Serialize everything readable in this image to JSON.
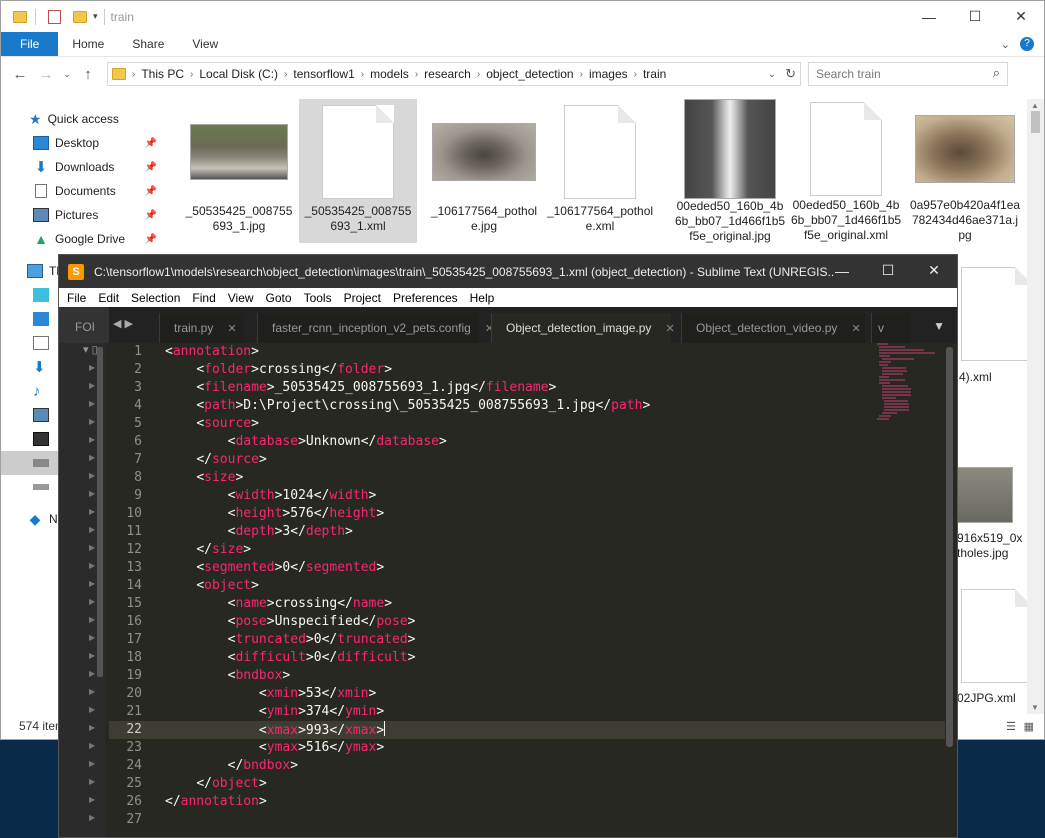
{
  "explorer": {
    "title": "train",
    "ribbon_tabs": [
      "File",
      "Home",
      "Share",
      "View"
    ],
    "breadcrumb": [
      "This PC",
      "Local Disk (C:)",
      "tensorflow1",
      "models",
      "research",
      "object_detection",
      "images",
      "train"
    ],
    "search_placeholder": "Search train",
    "nav": {
      "quick_access": "Quick access",
      "pinned": [
        "Desktop",
        "Downloads",
        "Documents",
        "Pictures",
        "Google Drive"
      ],
      "this_pc_partial": "Th",
      "network_partial": "N"
    },
    "files": [
      {
        "name": "_50535425_008755693_1.jpg",
        "type": "photo",
        "selected": false
      },
      {
        "name": "_50535425_008755693_1.xml",
        "type": "doc",
        "selected": true
      },
      {
        "name": "_106177564_pothole.jpg",
        "type": "photo",
        "selected": false
      },
      {
        "name": "_106177564_pothole.xml",
        "type": "doc",
        "selected": false
      },
      {
        "name": "00eded50_160b_4b6b_bb07_1d466f1b5f5e_original.jpg",
        "type": "photo",
        "selected": false
      },
      {
        "name": "00eded50_160b_4b6b_bb07_1d466f1b5f5e_original.xml",
        "type": "doc",
        "selected": false
      },
      {
        "name": "0a957e0b420a4f1ea782434d46ae371a.jpg",
        "type": "photo",
        "selected": false
      }
    ],
    "partial_labels": [
      "4).xml",
      "916x519_0x",
      "tholes.jpg",
      "02JPG.xml"
    ],
    "status": "574 item"
  },
  "sublime": {
    "title": "C:\\tensorflow1\\models\\research\\object_detection\\images\\train\\_50535425_008755693_1.xml (object_detection) - Sublime Text (UNREGIS...",
    "menu": [
      "File",
      "Edit",
      "Selection",
      "Find",
      "View",
      "Goto",
      "Tools",
      "Project",
      "Preferences",
      "Help"
    ],
    "sidebar_header": "FOI",
    "tabs": [
      "train.py",
      "faster_rcnn_inception_v2_pets.config",
      "Object_detection_image.py",
      "Object_detection_video.py",
      "v"
    ],
    "active_tab_index": 1,
    "current_line": 22,
    "lines": [
      "<annotation>",
      "    <folder>crossing</folder>",
      "    <filename>_50535425_008755693_1.jpg</filename>",
      "    <path>D:\\Project\\crossing\\_50535425_008755693_1.jpg</path>",
      "    <source>",
      "        <database>Unknown</database>",
      "    </source>",
      "    <size>",
      "        <width>1024</width>",
      "        <height>576</height>",
      "        <depth>3</depth>",
      "    </size>",
      "    <segmented>0</segmented>",
      "    <object>",
      "        <name>crossing</name>",
      "        <pose>Unspecified</pose>",
      "        <truncated>0</truncated>",
      "        <difficult>0</difficult>",
      "        <bndbox>",
      "            <xmin>53</xmin>",
      "            <ymin>374</ymin>",
      "            <xmax>993</xmax>",
      "            <ymax>516</ymax>",
      "        </bndbox>",
      "    </object>",
      "</annotation>",
      ""
    ]
  }
}
